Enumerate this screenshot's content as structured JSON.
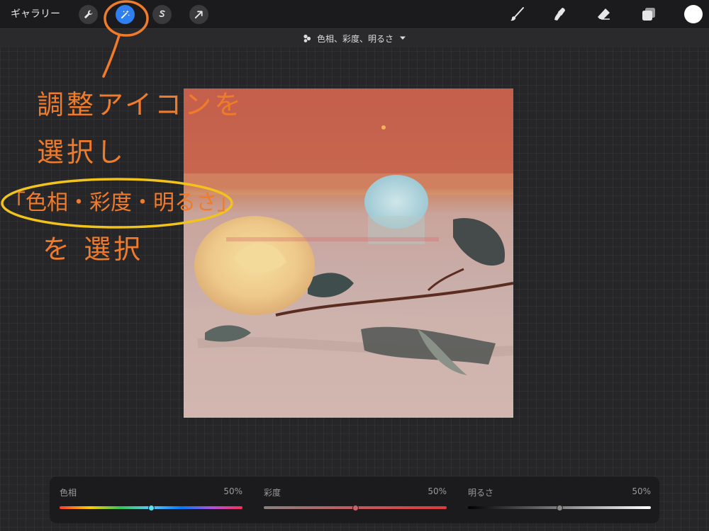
{
  "toolbar": {
    "gallery_label": "ギャラリー",
    "left_tools": [
      {
        "icon": "wrench-icon",
        "active": false
      },
      {
        "icon": "magic-wand-icon",
        "active": true
      },
      {
        "icon": "selection-s-icon",
        "active": false
      },
      {
        "icon": "arrow-icon",
        "active": false
      }
    ],
    "right_tools": [
      "brush-icon",
      "smudge-icon",
      "eraser-icon",
      "layers-icon"
    ],
    "current_color": "#ffffff",
    "active_color": "#2f7ff0"
  },
  "subbar": {
    "mode_title": "色相、彩度、明るさ"
  },
  "annotation": {
    "line1": "調整アイコンを",
    "line2": "選択し",
    "line3": "「色相・彩度・明るさ」",
    "line4": "を 選択",
    "color": "#f07b2a",
    "circle_color": "#f2c31c"
  },
  "sliders": [
    {
      "label": "色相",
      "value_text": "50%",
      "value": 0.5,
      "thumb_color": "#5de0f0"
    },
    {
      "label": "彩度",
      "value_text": "50%",
      "value": 0.5,
      "thumb_color": "#c9636a"
    },
    {
      "label": "明るさ",
      "value_text": "50%",
      "value": 0.5,
      "thumb_color": "#8a8a8a"
    }
  ]
}
